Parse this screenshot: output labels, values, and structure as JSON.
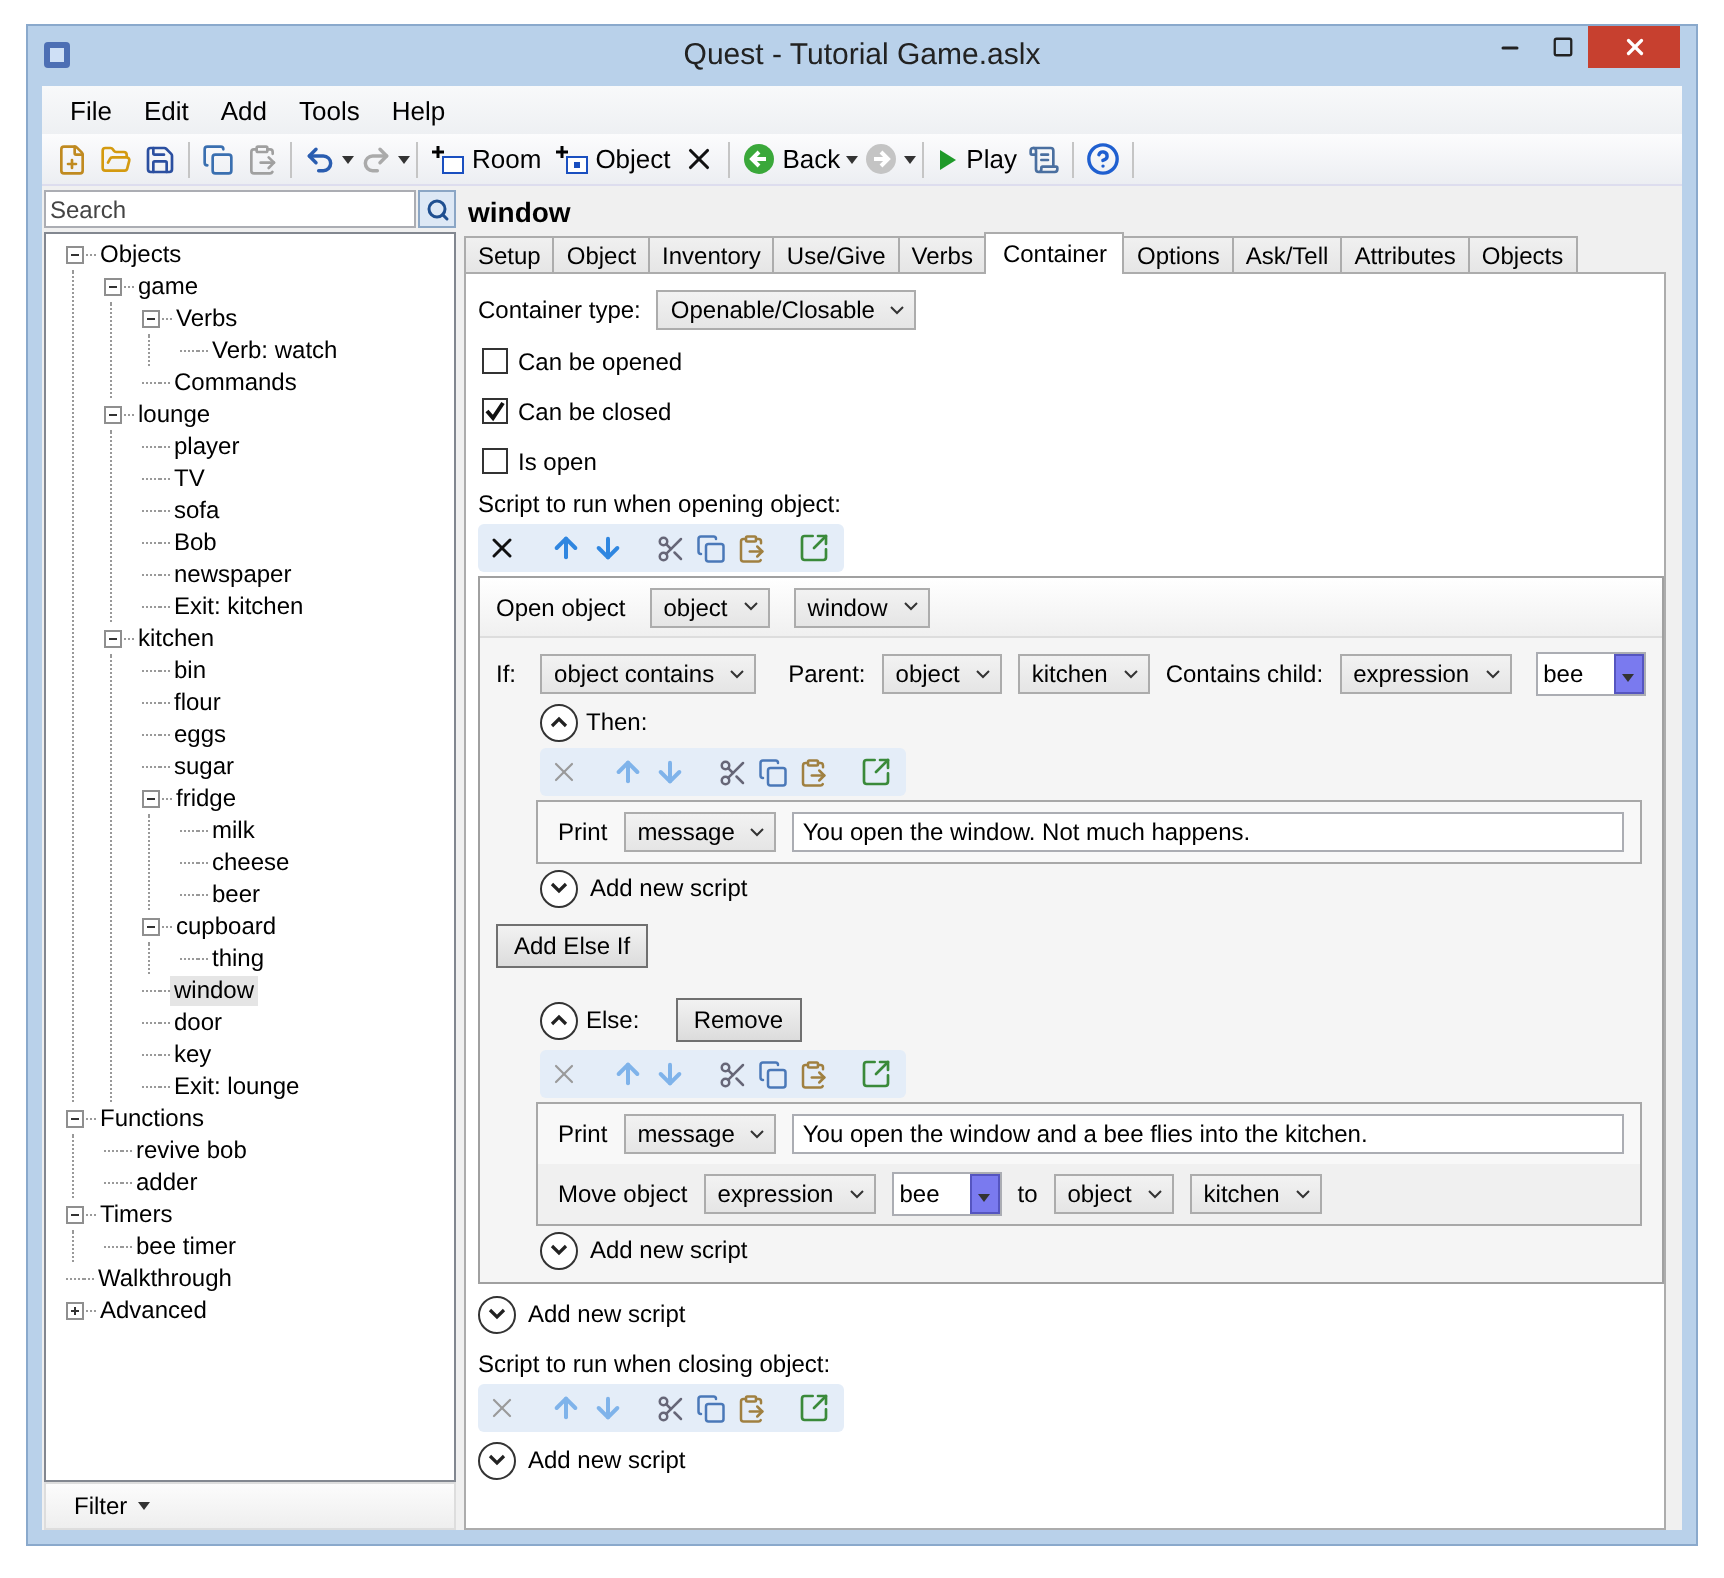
{
  "window": {
    "title": "Quest - Tutorial Game.aslx"
  },
  "menu": [
    "File",
    "Edit",
    "Add",
    "Tools",
    "Help"
  ],
  "toolbar": {
    "room": "Room",
    "object": "Object",
    "back": "Back",
    "play": "Play"
  },
  "search": {
    "placeholder": "Search"
  },
  "tree": [
    {
      "label": "Objects",
      "expanded": true,
      "selected": false,
      "children": [
        {
          "label": "game",
          "expanded": true,
          "selected": false,
          "children": [
            {
              "label": "Verbs",
              "expanded": true,
              "selected": false,
              "children": [
                {
                  "label": "Verb: watch",
                  "selected": false
                }
              ]
            },
            {
              "label": "Commands",
              "selected": false
            }
          ]
        },
        {
          "label": "lounge",
          "expanded": true,
          "selected": false,
          "children": [
            {
              "label": "player",
              "selected": false
            },
            {
              "label": "TV",
              "selected": false
            },
            {
              "label": "sofa",
              "selected": false
            },
            {
              "label": "Bob",
              "selected": false
            },
            {
              "label": "newspaper",
              "selected": false
            },
            {
              "label": "Exit: kitchen",
              "selected": false
            }
          ]
        },
        {
          "label": "kitchen",
          "expanded": true,
          "selected": false,
          "children": [
            {
              "label": "bin",
              "selected": false
            },
            {
              "label": "flour",
              "selected": false
            },
            {
              "label": "eggs",
              "selected": false
            },
            {
              "label": "sugar",
              "selected": false
            },
            {
              "label": "fridge",
              "expanded": true,
              "selected": false,
              "children": [
                {
                  "label": "milk",
                  "selected": false
                },
                {
                  "label": "cheese",
                  "selected": false
                },
                {
                  "label": "beer",
                  "selected": false
                }
              ]
            },
            {
              "label": "cupboard",
              "expanded": true,
              "selected": false,
              "children": [
                {
                  "label": "thing",
                  "selected": false
                }
              ]
            },
            {
              "label": "window",
              "selected": true
            },
            {
              "label": "door",
              "selected": false
            },
            {
              "label": "key",
              "selected": false
            },
            {
              "label": "Exit: lounge",
              "selected": false
            }
          ]
        }
      ]
    },
    {
      "label": "Functions",
      "expanded": true,
      "selected": false,
      "children": [
        {
          "label": "revive bob",
          "selected": false
        },
        {
          "label": "adder",
          "selected": false
        }
      ]
    },
    {
      "label": "Timers",
      "expanded": true,
      "selected": false,
      "children": [
        {
          "label": "bee timer",
          "selected": false
        }
      ]
    },
    {
      "label": "Walkthrough",
      "selected": false
    },
    {
      "label": "Advanced",
      "expanded": false,
      "selected": false
    }
  ],
  "filter": "Filter",
  "object_name": "window",
  "tabs": [
    {
      "label": "Setup",
      "selected": false
    },
    {
      "label": "Object",
      "selected": false
    },
    {
      "label": "Inventory",
      "selected": false
    },
    {
      "label": "Use/Give",
      "selected": false
    },
    {
      "label": "Verbs",
      "selected": false
    },
    {
      "label": "Container",
      "selected": true
    },
    {
      "label": "Options",
      "selected": false
    },
    {
      "label": "Ask/Tell",
      "selected": false
    },
    {
      "label": "Attributes",
      "selected": false
    },
    {
      "label": "Objects",
      "selected": false
    }
  ],
  "container_type": {
    "label": "Container type:",
    "value": "Openable/Closable"
  },
  "checkboxes": [
    {
      "label": "Can be opened",
      "checked": false
    },
    {
      "label": "Can be closed",
      "checked": true
    },
    {
      "label": "Is open",
      "checked": false
    }
  ],
  "open_script": {
    "label": "Script to run when opening object:",
    "toolbar_enabled": true,
    "open_row": {
      "label": "Open object",
      "selects": [
        "object",
        "window"
      ]
    },
    "if": {
      "label": "If:",
      "condition": "object contains",
      "parent_label": "Parent:",
      "parent_selects": [
        "object",
        "kitchen"
      ],
      "child_label": "Contains child:",
      "child_select": "expression",
      "child_value": "bee",
      "then": {
        "label": "Then:",
        "expanded": true,
        "toolbar_enabled": false,
        "scripts": [
          {
            "kind": "print",
            "label": "Print",
            "select": "message",
            "value": "You open the window. Not much happens."
          }
        ],
        "add_new": "Add new script"
      },
      "add_else_if": "Add Else If",
      "else": {
        "label": "Else:",
        "remove": "Remove",
        "expanded": true,
        "toolbar_enabled": false,
        "scripts": [
          {
            "kind": "print",
            "label": "Print",
            "select": "message",
            "value": "You open the window and a bee flies into the kitchen."
          },
          {
            "kind": "move",
            "label": "Move object",
            "select": "expression",
            "value": "bee",
            "to": "to",
            "target_selects": [
              "object",
              "kitchen"
            ]
          }
        ],
        "add_new": "Add new script"
      }
    },
    "add_new": "Add new script"
  },
  "close_script": {
    "label": "Script to run when closing object:",
    "toolbar_enabled": false,
    "add_new": "Add new script"
  }
}
